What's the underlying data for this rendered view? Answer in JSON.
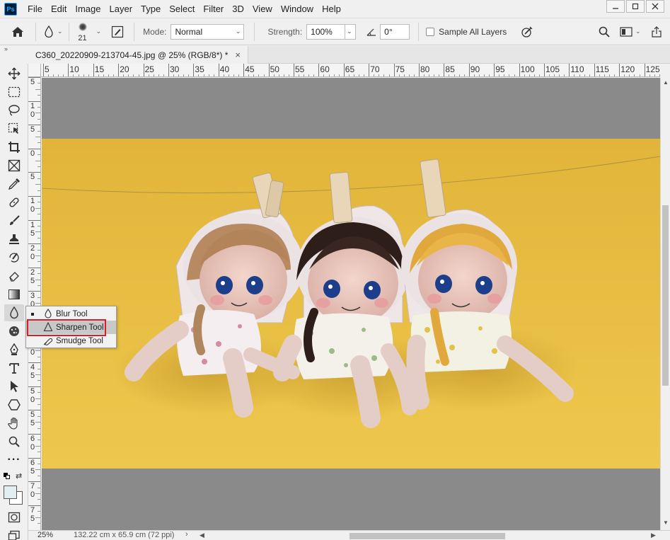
{
  "app": {
    "logo": "Ps"
  },
  "menu": [
    "File",
    "Edit",
    "Image",
    "Layer",
    "Type",
    "Select",
    "Filter",
    "3D",
    "View",
    "Window",
    "Help"
  ],
  "window_controls": [
    "minimize-icon",
    "restore-icon",
    "close-icon"
  ],
  "options": {
    "brush_size": "21",
    "mode_label": "Mode:",
    "mode_value": "Normal",
    "strength_label": "Strength:",
    "strength_value": "100%",
    "angle_value": "0°",
    "sample_all_layers_label": "Sample All Layers",
    "sample_all_layers_checked": false
  },
  "document": {
    "tab_title": "C360_20220909-213704-45.jpg @ 25% (RGB/8*) *",
    "close_symbol": "×"
  },
  "ruler": {
    "top": [
      "5",
      "10",
      "15",
      "20",
      "25",
      "30",
      "35",
      "40",
      "45",
      "50",
      "55",
      "60",
      "65",
      "70",
      "75",
      "80",
      "85",
      "90",
      "95",
      "100",
      "105",
      "110",
      "115",
      "120",
      "125"
    ],
    "left": [
      "5",
      "10",
      "5",
      "0",
      "5",
      "10",
      "15",
      "20",
      "25",
      "30",
      "35",
      "40",
      "45",
      "50",
      "55",
      "60",
      "65",
      "70",
      "75"
    ]
  },
  "flyout": {
    "items": [
      {
        "label": "Blur Tool",
        "icon": "blur-drop-icon",
        "current": true
      },
      {
        "label": "Sharpen Tool",
        "icon": "sharpen-triangle-icon",
        "hovered": true
      },
      {
        "label": "Smudge Tool",
        "icon": "smudge-finger-icon"
      }
    ]
  },
  "status": {
    "zoom": "25%",
    "doc_size": "132.22 cm x 65.9 cm (72 ppi)",
    "arrow": "›"
  },
  "colors": {
    "canvas_bg": "#8a8a8a",
    "image_bg": "#e8bb3e",
    "highlight": "#d61f26",
    "foreground": "#e3eef2",
    "background": "#ffffff"
  }
}
